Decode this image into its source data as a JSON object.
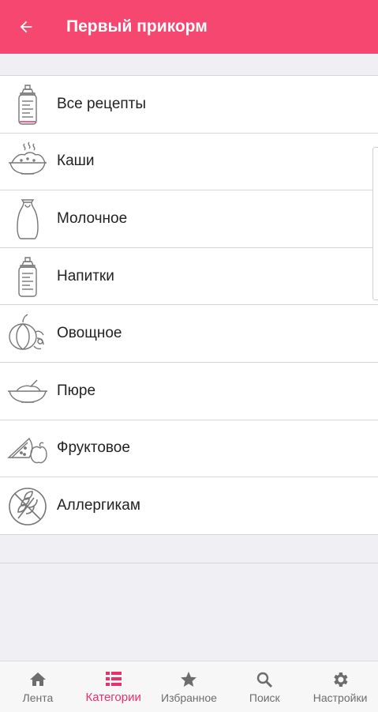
{
  "header": {
    "title": "Первый прикорм",
    "back_icon": "arrow-back-icon"
  },
  "categories": [
    {
      "label": "Все рецепты",
      "icon": "baby-bottle-icon"
    },
    {
      "label": "Каши",
      "icon": "porridge-bowl-icon"
    },
    {
      "label": "Молочное",
      "icon": "milk-jug-icon"
    },
    {
      "label": "Напитки",
      "icon": "baby-bottle-icon"
    },
    {
      "label": "Овощное",
      "icon": "pumpkin-icon"
    },
    {
      "label": "Пюре",
      "icon": "puree-bowl-icon"
    },
    {
      "label": "Фруктовое",
      "icon": "watermelon-apple-icon"
    },
    {
      "label": "Аллергикам",
      "icon": "no-wheat-icon"
    }
  ],
  "bottom_nav": [
    {
      "label": "Лента",
      "icon": "home-icon",
      "active": false
    },
    {
      "label": "Категории",
      "icon": "list-icon",
      "active": true
    },
    {
      "label": "Избранное",
      "icon": "star-icon",
      "active": false
    },
    {
      "label": "Поиск",
      "icon": "search-icon",
      "active": false
    },
    {
      "label": "Настройки",
      "icon": "gear-icon",
      "active": false
    }
  ],
  "colors": {
    "accent": "#f5476f",
    "active_tab": "#e8306a",
    "inactive_tab": "#6d6d6d",
    "background": "#efeff4"
  }
}
